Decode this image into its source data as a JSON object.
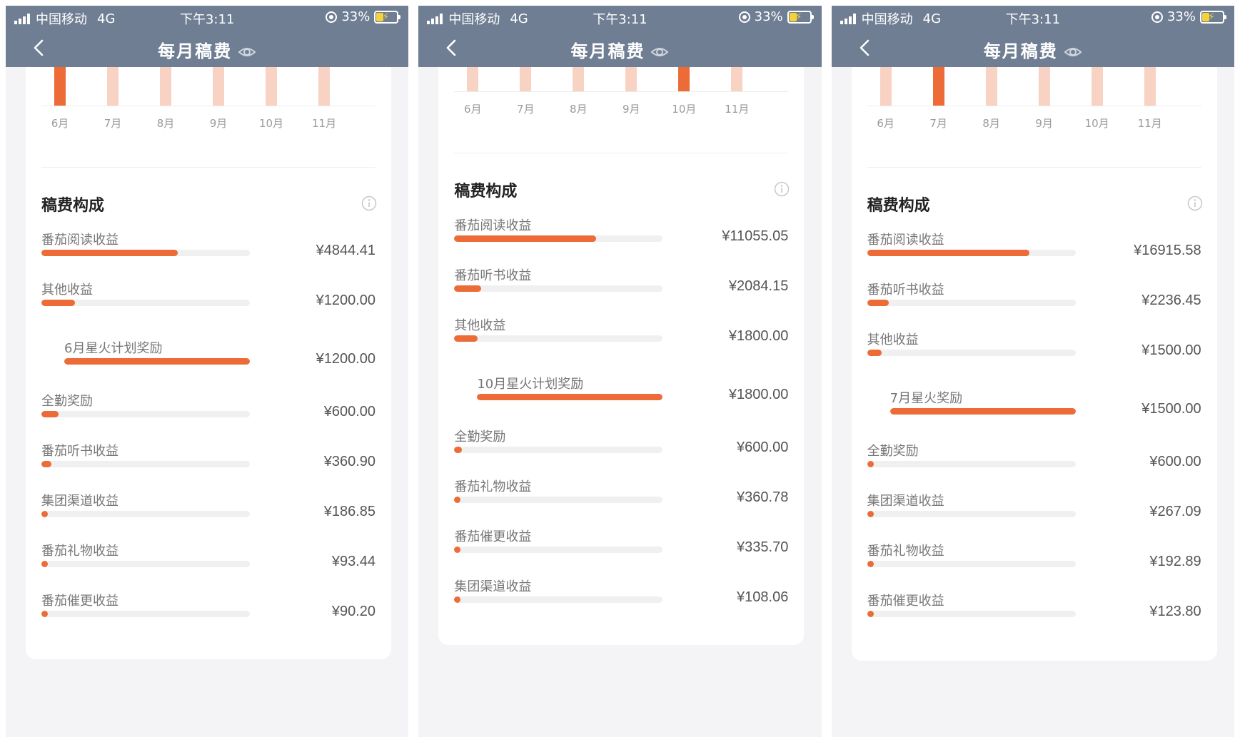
{
  "colors": {
    "header": "#6f7e93",
    "accent": "#ec6b37",
    "accent_light": "#f8d3c4",
    "track": "#f0f0f0"
  },
  "screens": [
    {
      "status": {
        "carrier": "中国移动",
        "network": "4G",
        "time": "下午3:11",
        "battery": "33%"
      },
      "title": "每月稿费",
      "chart": {
        "months": [
          "6月",
          "7月",
          "8月",
          "9月",
          "10月",
          "11月"
        ],
        "selected_index": 0
      },
      "section_title": "稿费构成",
      "items": [
        {
          "label": "番茄阅读收益",
          "amount": "¥4844.41",
          "progress": 0.655,
          "sub": false
        },
        {
          "label": "其他收益",
          "amount": "¥1200.00",
          "progress": 0.162,
          "sub": false
        },
        {
          "label": "6月星火计划奖励",
          "amount": "¥1200.00",
          "progress": 1.0,
          "sub": true
        },
        {
          "label": "全勤奖励",
          "amount": "¥600.00",
          "progress": 0.081,
          "sub": false
        },
        {
          "label": "番茄听书收益",
          "amount": "¥360.90",
          "progress": 0.049,
          "sub": false
        },
        {
          "label": "集团渠道收益",
          "amount": "¥186.85",
          "progress": 0.025,
          "sub": false
        },
        {
          "label": "番茄礼物收益",
          "amount": "¥93.44",
          "progress": 0.013,
          "sub": false
        },
        {
          "label": "番茄催更收益",
          "amount": "¥90.20",
          "progress": 0.012,
          "sub": false
        }
      ]
    },
    {
      "status": {
        "carrier": "中国移动",
        "network": "4G",
        "time": "下午3:11",
        "battery": "33%"
      },
      "title": "每月稿费",
      "chart": {
        "months": [
          "6月",
          "7月",
          "8月",
          "9月",
          "10月",
          "11月"
        ],
        "selected_index": 4
      },
      "section_title": "稿费构成",
      "items": [
        {
          "label": "番茄阅读收益",
          "amount": "¥11055.05",
          "progress": 0.68,
          "sub": false
        },
        {
          "label": "番茄听书收益",
          "amount": "¥2084.15",
          "progress": 0.128,
          "sub": false
        },
        {
          "label": "其他收益",
          "amount": "¥1800.00",
          "progress": 0.111,
          "sub": false
        },
        {
          "label": "10月星火计划奖励",
          "amount": "¥1800.00",
          "progress": 1.0,
          "sub": true
        },
        {
          "label": "全勤奖励",
          "amount": "¥600.00",
          "progress": 0.037,
          "sub": false
        },
        {
          "label": "番茄礼物收益",
          "amount": "¥360.78",
          "progress": 0.022,
          "sub": false
        },
        {
          "label": "番茄催更收益",
          "amount": "¥335.70",
          "progress": 0.021,
          "sub": false
        },
        {
          "label": "集团渠道收益",
          "amount": "¥108.06",
          "progress": 0.007,
          "sub": false
        }
      ]
    },
    {
      "status": {
        "carrier": "中国移动",
        "network": "4G",
        "time": "下午3:11",
        "battery": "33%"
      },
      "title": "每月稿费",
      "chart": {
        "months": [
          "6月",
          "7月",
          "8月",
          "9月",
          "10月",
          "11月"
        ],
        "selected_index": 1
      },
      "section_title": "稿费构成",
      "items": [
        {
          "label": "番茄阅读收益",
          "amount": "¥16915.58",
          "progress": 0.78,
          "sub": false
        },
        {
          "label": "番茄听书收益",
          "amount": "¥2236.45",
          "progress": 0.103,
          "sub": false
        },
        {
          "label": "其他收益",
          "amount": "¥1500.00",
          "progress": 0.069,
          "sub": false
        },
        {
          "label": "7月星火奖励",
          "amount": "¥1500.00",
          "progress": 1.0,
          "sub": true
        },
        {
          "label": "全勤奖励",
          "amount": "¥600.00",
          "progress": 0.028,
          "sub": false
        },
        {
          "label": "集团渠道收益",
          "amount": "¥267.09",
          "progress": 0.012,
          "sub": false
        },
        {
          "label": "番茄礼物收益",
          "amount": "¥192.89",
          "progress": 0.009,
          "sub": false
        },
        {
          "label": "番茄催更收益",
          "amount": "¥123.80",
          "progress": 0.006,
          "sub": false
        }
      ]
    }
  ]
}
